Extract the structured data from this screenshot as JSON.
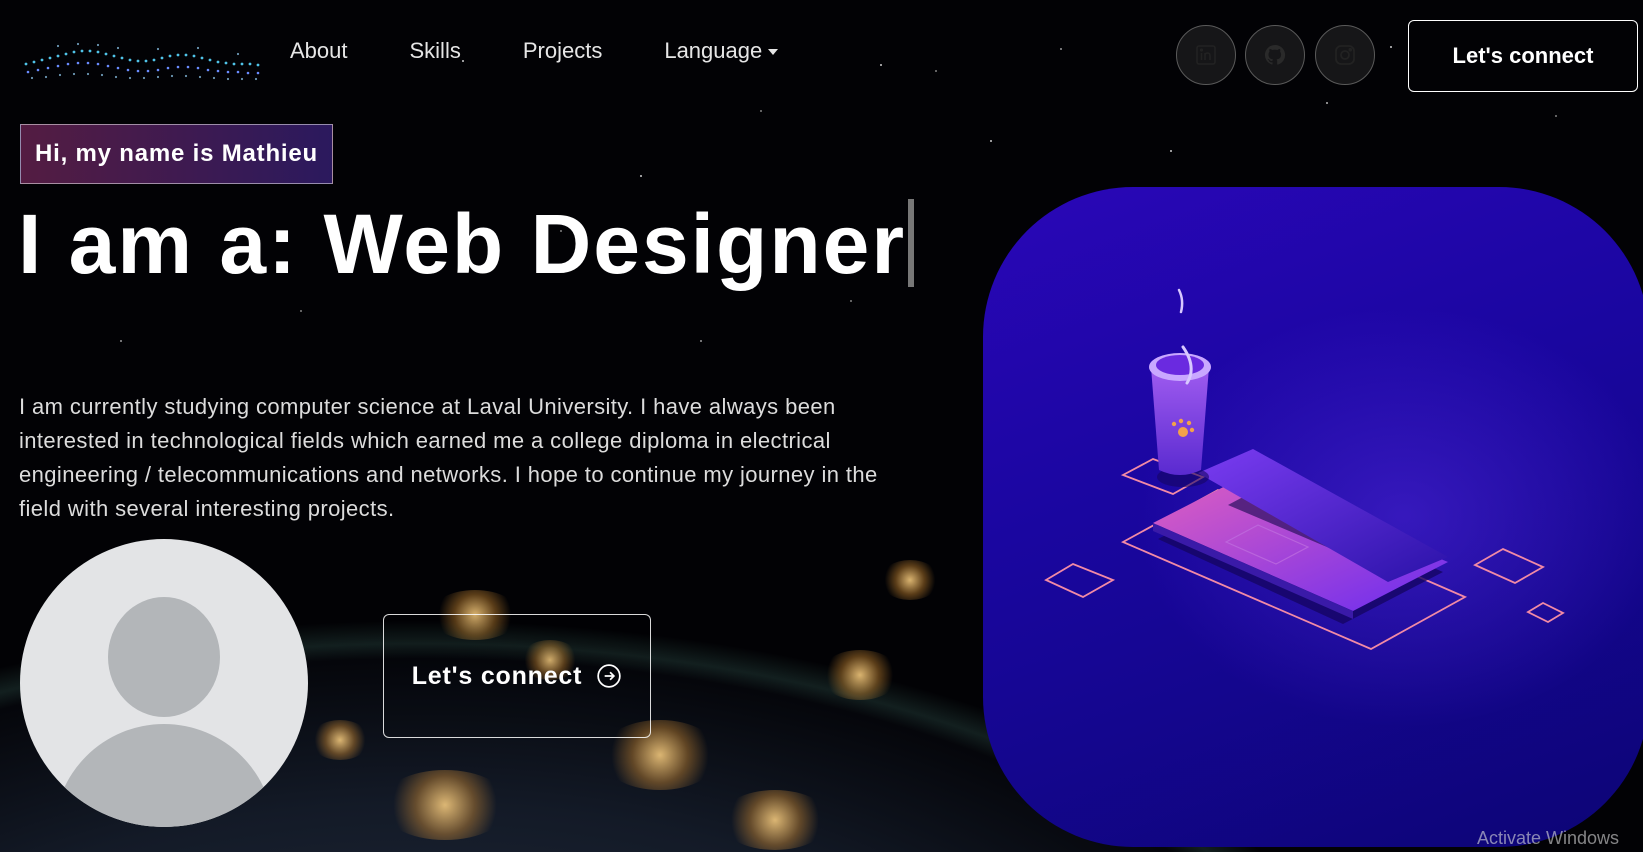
{
  "nav": {
    "links": [
      "About",
      "Skills",
      "Projects"
    ],
    "language_label": "Language",
    "social": [
      {
        "name": "linkedin-icon"
      },
      {
        "name": "github-icon"
      },
      {
        "name": "instagram-icon"
      }
    ],
    "cta_label": "Let's connect"
  },
  "hero": {
    "tagline": "Hi, my name is Mathieu",
    "headline": "I am a: Web Designer",
    "bio": "I am currently studying computer science at Laval University. I have always been interested in technological fields which earned me a college diploma in electrical engineering / telecommunications and networks. I hope to continue my journey in the field with several interesting projects.",
    "cta_label": "Let's connect",
    "cta_icon": "arrow-right-circle-icon"
  },
  "avatar": {
    "icon": "default-user-icon"
  },
  "illustration": {
    "icons": [
      "coffee-cup-icon",
      "laptop-icon"
    ]
  },
  "system": {
    "watermark": "Activate Windows"
  },
  "colors": {
    "tagline_gradient_start": "#aa367c",
    "tagline_gradient_end": "#4a2fbd",
    "illustration_bg": "#1a06a0",
    "accent_pink": "#f28aa5"
  }
}
